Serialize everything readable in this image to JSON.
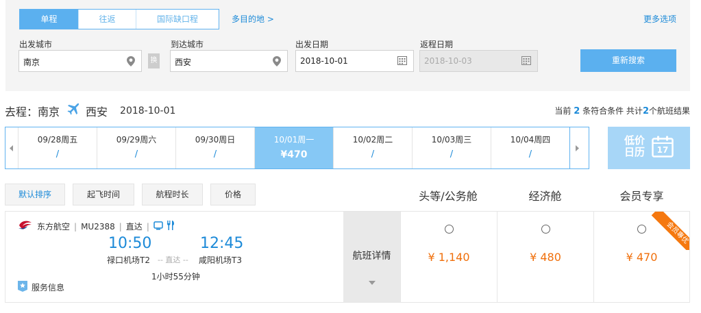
{
  "search": {
    "trip_tabs": [
      "单程",
      "往返",
      "国际缺口程"
    ],
    "multi_destination": "多目的地 >",
    "more_options": "更多选项",
    "departure_city_label": "出发城市",
    "departure_city": "南京",
    "arrival_city_label": "到达城市",
    "arrival_city": "西安",
    "swap_label": "换",
    "depart_date_label": "出发日期",
    "depart_date": "2018-10-01",
    "return_date_label": "返程日期",
    "return_date": "2018-10-03",
    "research_button": "重新搜索"
  },
  "route": {
    "prefix": "去程：",
    "from": "南京",
    "to": "西安",
    "date": "2018-10-01"
  },
  "result_summary": {
    "t1": "当前",
    "matched": "2",
    "t2": "条符合条件 共计",
    "total": "2",
    "t3": "个航班结果"
  },
  "date_strip": [
    {
      "date": "09/28周五",
      "price": "/"
    },
    {
      "date": "09/29周六",
      "price": "/"
    },
    {
      "date": "09/30周日",
      "price": "/"
    },
    {
      "date": "10/01周一",
      "price": "¥470"
    },
    {
      "date": "10/02周二",
      "price": "/"
    },
    {
      "date": "10/03周三",
      "price": "/"
    },
    {
      "date": "10/04周四",
      "price": "/"
    }
  ],
  "low_price_calendar": {
    "line1": "低价",
    "line2": "日历",
    "day": "17"
  },
  "sort": [
    "默认排序",
    "起飞时间",
    "航程时长",
    "价格"
  ],
  "cabin_headers": [
    "头等/公务舱",
    "经济舱",
    "会员专享"
  ],
  "flight": {
    "airline": "东方航空",
    "flight_no": "MU2388",
    "type": "直达",
    "dep_time": "10:50",
    "arr_time": "12:45",
    "dep_airport": "禄口机场T2",
    "arr_airport": "咸阳机场T3",
    "stop": "-- 直达 --",
    "duration": "1小时55分钟",
    "service": "服务信息",
    "detail": "航班详情",
    "fares": [
      "¥ 1,140",
      "¥ 480",
      "¥ 470"
    ],
    "member_badge": "会员專优"
  },
  "colors": {
    "accent": "#5bb0ef",
    "price": "#f06f0b",
    "link": "#1c8ad8"
  }
}
